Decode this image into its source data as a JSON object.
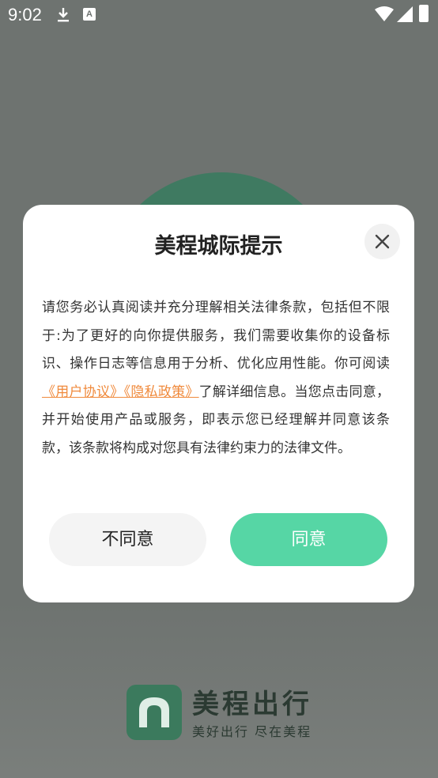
{
  "status_bar": {
    "time": "9:02",
    "a_icon": "A"
  },
  "splash": {
    "brand_name": "美程出行",
    "slogan": "美好出行 尽在美程"
  },
  "dialog": {
    "title": "美程城际提示",
    "body_part1": "请您务必认真阅读并充分理解相关法律条款，包括但不限于:为了更好的向你提供服务，我们需要收集你的设备标识、操作日志等信息用于分析、优化应用性能。你可阅读",
    "link_user_agreement": "《用户协议》",
    "link_privacy_policy": "《隐私政策》",
    "body_part2": "了解详细信息。当您点击同意，并开始使用产品或服务，即表示您已经理解并同意该条款，该条款将构成对您具有法律约束力的法律文件。",
    "disagree_label": "不同意",
    "agree_label": "同意"
  },
  "colors": {
    "accent": "#56d6a5",
    "link": "#f08a3c",
    "brand_green": "#3b7a5d"
  }
}
